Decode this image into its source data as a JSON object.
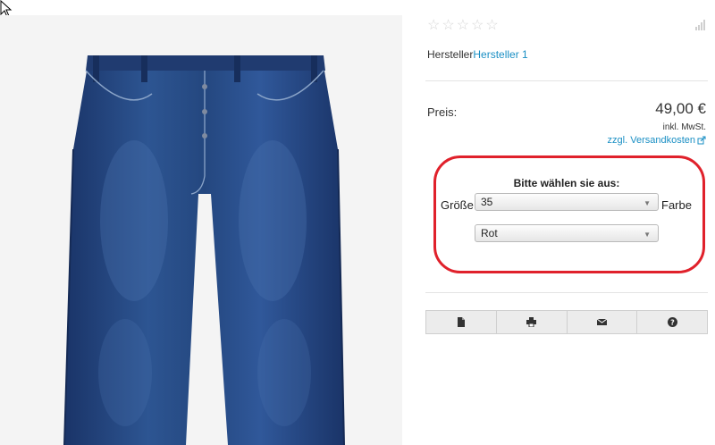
{
  "rating": {
    "stars": "☆☆☆☆☆"
  },
  "manufacturer": {
    "label": "Hersteller",
    "link": "Hersteller 1"
  },
  "price": {
    "label": "Preis:",
    "value": "49,00 €",
    "tax_note": "inkl. MwSt.",
    "shipping_link": "zzgl. Versandkosten"
  },
  "variants": {
    "title": "Bitte wählen sie aus:",
    "size_label": "Größe",
    "size_value": "35",
    "color_label": "Farbe",
    "color_value": "Rot"
  },
  "colors": {
    "highlight": "#e0212b",
    "link": "#1a8fc4",
    "denim": "#213f7a"
  },
  "icons": [
    "document-icon",
    "print-icon",
    "mail-icon",
    "help-icon"
  ]
}
